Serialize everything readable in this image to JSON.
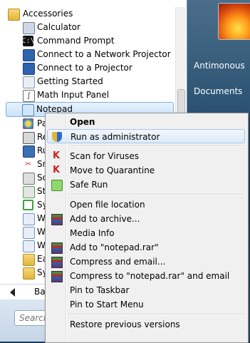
{
  "programs": [
    {
      "label": "Accessories",
      "icon": "folder-icon",
      "type": "folder"
    },
    {
      "label": "Calculator",
      "icon": "calculator-icon"
    },
    {
      "label": "Command Prompt",
      "icon": "command-prompt-icon",
      "glyph": "C:\\"
    },
    {
      "label": "Connect to a Network Projector",
      "icon": "network-projector-icon"
    },
    {
      "label": "Connect to a Projector",
      "icon": "projector-icon"
    },
    {
      "label": "Getting Started",
      "icon": "getting-started-icon"
    },
    {
      "label": "Math Input Panel",
      "icon": "math-input-icon",
      "glyph": "∫"
    },
    {
      "label": "Notepad",
      "icon": "notepad-icon",
      "selected": true
    },
    {
      "label": "Pa",
      "icon": "paint-icon"
    },
    {
      "label": "Re",
      "icon": "remote-desktop-icon"
    },
    {
      "label": "Ru",
      "icon": "run-icon"
    },
    {
      "label": "Sn",
      "icon": "snipping-tool-icon",
      "glyph": "✂"
    },
    {
      "label": "So",
      "icon": "sound-recorder-icon"
    },
    {
      "label": "St",
      "icon": "sticky-notes-icon"
    },
    {
      "label": "Sy",
      "icon": "sync-center-icon"
    },
    {
      "label": "W",
      "icon": "windows-explorer-icon"
    },
    {
      "label": "W",
      "icon": "windows-mobility-icon"
    },
    {
      "label": "W",
      "icon": "wordpad-icon"
    },
    {
      "label": "Ea",
      "icon": "folder-icon"
    },
    {
      "label": "Sy",
      "icon": "folder-icon"
    }
  ],
  "back_label": "Ba",
  "search": {
    "placeholder": "Search"
  },
  "right_pane": {
    "items": [
      "Antimonous",
      "Documents"
    ]
  },
  "context_menu": [
    {
      "label": "Open",
      "bold": true
    },
    {
      "label": "Run as administrator",
      "icon": "uac-shield-icon",
      "hover": true
    },
    {
      "sep": true
    },
    {
      "label": "Scan for Viruses",
      "icon": "kaspersky-icon",
      "glyph": "K"
    },
    {
      "label": "Move to Quarantine",
      "icon": "kaspersky-icon",
      "glyph": "K"
    },
    {
      "label": "Safe Run",
      "icon": "safe-run-icon"
    },
    {
      "sep": true
    },
    {
      "label": "Open file location"
    },
    {
      "label": "Add to archive...",
      "icon": "winrar-icon"
    },
    {
      "label": "Media Info"
    },
    {
      "label": "Add to \"notepad.rar\"",
      "icon": "winrar-icon"
    },
    {
      "label": "Compress and email...",
      "icon": "winrar-icon"
    },
    {
      "label": "Compress to \"notepad.rar\" and email",
      "icon": "winrar-icon"
    },
    {
      "label": "Pin to Taskbar"
    },
    {
      "label": "Pin to Start Menu"
    },
    {
      "sep": true
    },
    {
      "label": "Restore previous versions"
    }
  ]
}
